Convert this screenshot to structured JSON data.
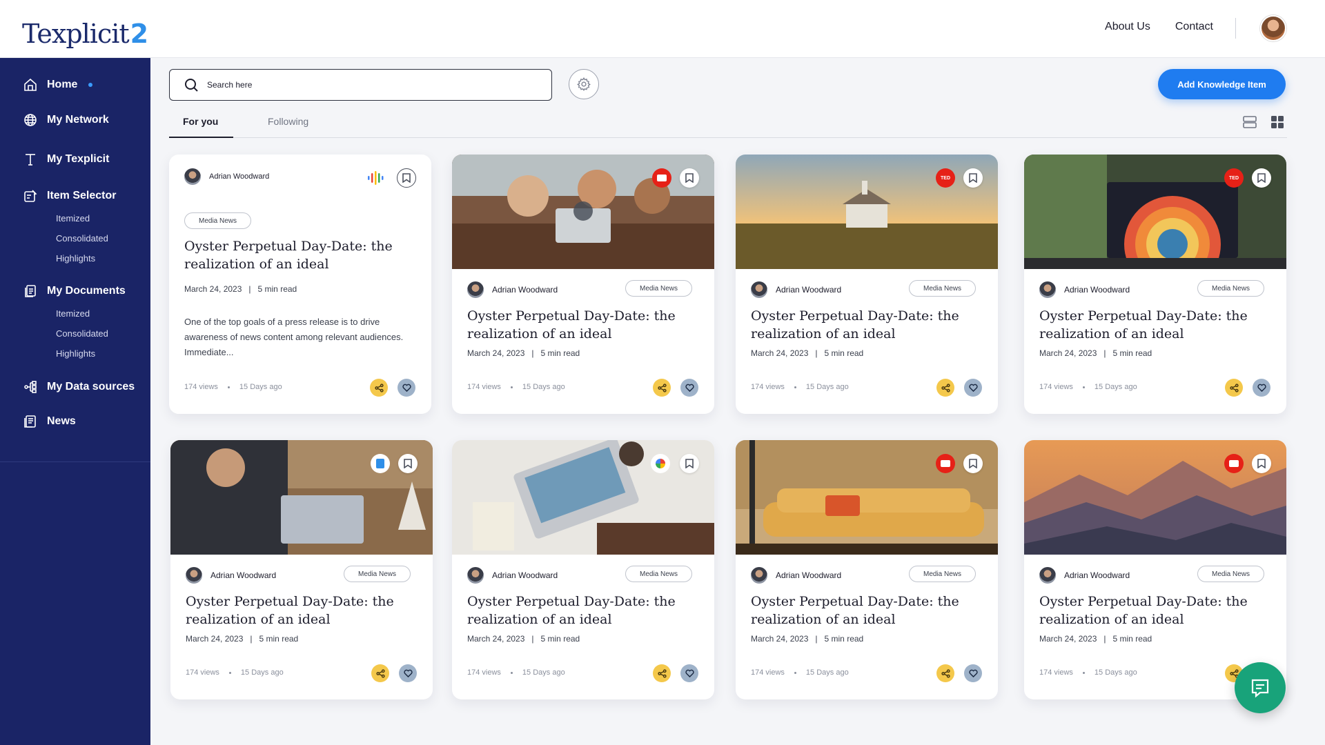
{
  "brand": {
    "logo_text": "Texplicit",
    "logo_num": "2"
  },
  "header": {
    "links": [
      "About Us",
      "Contact"
    ]
  },
  "sidebar": {
    "items": [
      {
        "label": "Home",
        "icon": "home-icon",
        "active": true
      },
      {
        "label": "My Network",
        "icon": "globe-icon"
      },
      {
        "label": "My Texplicit",
        "icon": "text-icon"
      },
      {
        "label": "Item Selector",
        "icon": "selector-icon",
        "subitems": [
          "Itemized",
          "Consolidated",
          "Highlights"
        ]
      },
      {
        "label": "My Documents",
        "icon": "documents-icon",
        "subitems": [
          "Itemized",
          "Consolidated",
          "Highlights"
        ]
      },
      {
        "label": "My Data sources",
        "icon": "data-sources-icon"
      },
      {
        "label": "News",
        "icon": "news-icon"
      }
    ]
  },
  "search": {
    "placeholder": "Search here"
  },
  "actions": {
    "add_label": "Add Knowledge Item"
  },
  "tabs": {
    "for_you": "For you",
    "following": "Following"
  },
  "cards": [
    {
      "author": "Adrian Woodward",
      "tag": "Media News",
      "title": "Oyster Perpetual Day-Date: the realization of an ideal",
      "date": "March 24, 2023",
      "read": "5 min read",
      "views": "174 views",
      "ago": "15 Days ago",
      "excerpt": "One of the top goals of a press release is to drive awareness of news content among relevant audiences. Immediate...",
      "source": "podcast-icon"
    },
    {
      "author": "Adrian Woodward",
      "tag": "Media News",
      "title": "Oyster Perpetual Day-Date: the realization of an ideal",
      "date": "March 24, 2023",
      "read": "5 min read",
      "views": "174 views",
      "ago": "15 Days ago",
      "source": "youtube-icon"
    },
    {
      "author": "Adrian Woodward",
      "tag": "Media News",
      "title": "Oyster Perpetual Day-Date: the realization of an ideal",
      "date": "March 24, 2023",
      "read": "5 min read",
      "views": "174 views",
      "ago": "15 Days ago",
      "source": "ted-icon",
      "source_text": "TED"
    },
    {
      "author": "Adrian Woodward",
      "tag": "Media News",
      "title": "Oyster Perpetual Day-Date: the realization of an ideal",
      "date": "March 24, 2023",
      "read": "5 min read",
      "views": "174 views",
      "ago": "15 Days ago",
      "source": "ted-icon",
      "source_text": "TED"
    },
    {
      "author": "Adrian Woodward",
      "tag": "Media News",
      "title": "Oyster Perpetual Day-Date: the realization of an ideal",
      "date": "March 24, 2023",
      "read": "5 min read",
      "views": "174 views",
      "ago": "15 Days ago",
      "source": "document-icon"
    },
    {
      "author": "Adrian Woodward",
      "tag": "Media News",
      "title": "Oyster Perpetual Day-Date: the realization of an ideal",
      "date": "March 24, 2023",
      "read": "5 min read",
      "views": "174 views",
      "ago": "15 Days ago",
      "source": "google-icon"
    },
    {
      "author": "Adrian Woodward",
      "tag": "Media News",
      "title": "Oyster Perpetual Day-Date: the realization of an ideal",
      "date": "March 24, 2023",
      "read": "5 min read",
      "views": "174 views",
      "ago": "15 Days ago",
      "source": "youtube-icon"
    },
    {
      "author": "Adrian Woodward",
      "tag": "Media News",
      "title": "Oyster Perpetual Day-Date: the realization of an ideal",
      "date": "March 24, 2023",
      "read": "5 min read",
      "views": "174 views",
      "ago": "15 Days ago",
      "source": "youtube-icon"
    }
  ],
  "colors": {
    "sidebar": "#1a2466",
    "accent": "#1f7cf0",
    "share": "#f4c84b",
    "like": "#9eb2c9",
    "chat": "#18a37a"
  }
}
